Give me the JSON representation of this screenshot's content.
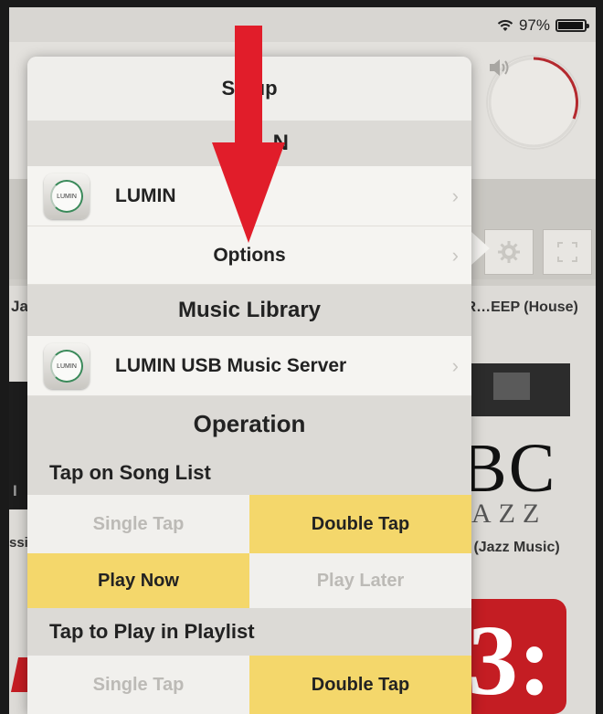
{
  "status": {
    "battery": "97%",
    "battery_level": 0.97
  },
  "background": {
    "left_label_1": "Ja",
    "right_label_1": "AR…EEP (House)",
    "right_label_2": "zz (Jazz Music)",
    "left_label_2": "ssi",
    "album_abc": "BC",
    "album_azz": "AZZ",
    "album_red": "3:",
    "left_album_text": "I"
  },
  "popover": {
    "title": "Setup",
    "sections": {
      "lumin_header": "N",
      "music_library": "Music Library",
      "operation": "Operation"
    },
    "rows": {
      "lumin": "LUMIN",
      "options": "Options",
      "usb_server": "LUMIN USB Music Server"
    },
    "icon_text": "LUMIN",
    "tap_song_list": {
      "heading": "Tap on Song List",
      "single": "Single Tap",
      "double": "Double Tap",
      "play_now": "Play Now",
      "play_later": "Play Later"
    },
    "tap_playlist": {
      "heading": "Tap to Play in Playlist",
      "single": "Single Tap",
      "double": "Double Tap"
    }
  },
  "colors": {
    "selected": "#f4d76b",
    "arrow": "#e11d2a",
    "accent_ring": "#3a8a5a"
  }
}
